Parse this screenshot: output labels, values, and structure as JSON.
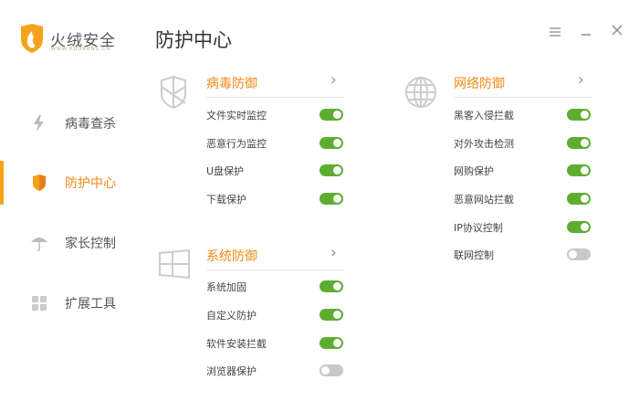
{
  "app": {
    "logo_text": "火绒安全",
    "logo_sub": "WWW.HUORONG.CN",
    "page_title": "防护中心"
  },
  "window": {
    "menu_icon": "menu-icon",
    "minimize_icon": "minimize-icon",
    "close_icon": "close-icon"
  },
  "sidebar": {
    "items": [
      {
        "label": "病毒查杀",
        "icon": "lightning-icon"
      },
      {
        "label": "防护中心",
        "icon": "shield-icon",
        "active": true
      },
      {
        "label": "家长控制",
        "icon": "umbrella-icon"
      },
      {
        "label": "扩展工具",
        "icon": "grid-icon"
      }
    ]
  },
  "sections": [
    {
      "title": "病毒防御",
      "icon": "shield-outline-icon",
      "items": [
        {
          "label": "文件实时监控",
          "on": true
        },
        {
          "label": "恶意行为监控",
          "on": true
        },
        {
          "label": "U盘保护",
          "on": true
        },
        {
          "label": "下载保护",
          "on": true
        }
      ]
    },
    {
      "title": "系统防御",
      "icon": "windows-icon",
      "items": [
        {
          "label": "系统加固",
          "on": true
        },
        {
          "label": "自定义防护",
          "on": true
        },
        {
          "label": "软件安装拦截",
          "on": true
        },
        {
          "label": "浏览器保护",
          "on": false
        }
      ]
    },
    {
      "title": "网络防御",
      "icon": "globe-icon",
      "items": [
        {
          "label": "黑客入侵拦截",
          "on": true
        },
        {
          "label": "对外攻击检测",
          "on": true
        },
        {
          "label": "网购保护",
          "on": true
        },
        {
          "label": "恶意网站拦截",
          "on": true
        },
        {
          "label": "IP协议控制",
          "on": true
        },
        {
          "label": "联网控制",
          "on": false
        }
      ]
    }
  ],
  "colors": {
    "accent": "#f08a16",
    "toggle_on": "#5ead31",
    "toggle_off": "#c8c8c8"
  }
}
